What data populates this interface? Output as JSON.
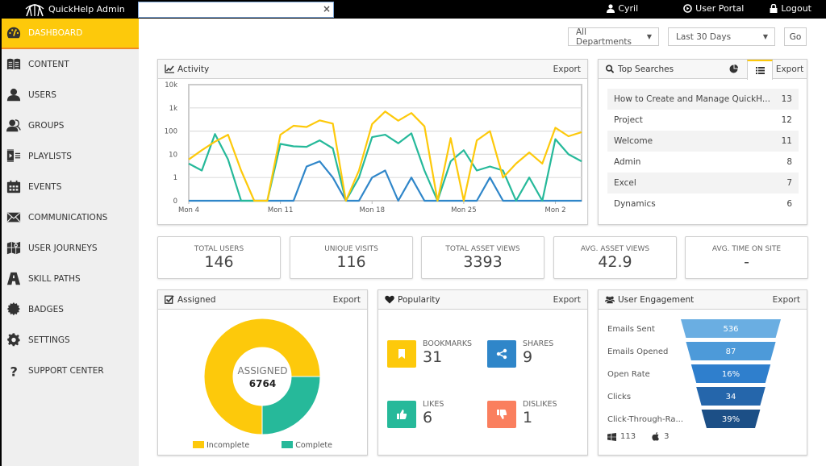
{
  "app": {
    "title": "QuickHelp Admin",
    "search_value": "",
    "user_name": "Cyril",
    "user_portal_label": "User Portal",
    "logout_label": "Logout"
  },
  "sidebar": {
    "items": [
      {
        "label": "DASHBOARD",
        "icon": "dashboard-icon",
        "active": true
      },
      {
        "label": "CONTENT",
        "icon": "book-icon"
      },
      {
        "label": "USERS",
        "icon": "user-icon"
      },
      {
        "label": "GROUPS",
        "icon": "group-icon"
      },
      {
        "label": "PLAYLISTS",
        "icon": "playlist-icon"
      },
      {
        "label": "EVENTS",
        "icon": "calendar-icon"
      },
      {
        "label": "COMMUNICATIONS",
        "icon": "envelope-icon"
      },
      {
        "label": "USER JOURNEYS",
        "icon": "map-icon"
      },
      {
        "label": "SKILL PATHS",
        "icon": "road-icon"
      },
      {
        "label": "BADGES",
        "icon": "badge-icon"
      },
      {
        "label": "SETTINGS",
        "icon": "gear-icon"
      },
      {
        "label": "SUPPORT CENTER",
        "icon": "question-icon"
      }
    ]
  },
  "filters": {
    "department": "All Departments",
    "range": "Last 30 Days",
    "go_label": "Go"
  },
  "activity": {
    "title": "Activity",
    "export_label": "Export"
  },
  "chart_data": {
    "type": "line",
    "title": "Activity",
    "yscale": "log",
    "y_ticks": [
      "0",
      "1",
      "10",
      "100",
      "1k",
      "10k"
    ],
    "x_ticks": [
      "Mon 4",
      "Mon 11",
      "Mon 18",
      "Mon 25",
      "Mon 2"
    ],
    "x_tick_day_index": [
      0,
      7,
      14,
      21,
      28
    ],
    "days": 31,
    "ylim": [
      0,
      10000
    ],
    "grid": true,
    "series": [
      {
        "name": "yellow",
        "color": "#fdc90b",
        "values": [
          6,
          15,
          35,
          70,
          2,
          0,
          0,
          70,
          170,
          150,
          290,
          210,
          0,
          2,
          200,
          700,
          280,
          600,
          160,
          0,
          50,
          0,
          40,
          100,
          1,
          4,
          12,
          4,
          140,
          60,
          90
        ]
      },
      {
        "name": "teal",
        "color": "#26b99a",
        "values": [
          4,
          2,
          75,
          6,
          0,
          0,
          0,
          28,
          22,
          21,
          40,
          18,
          0,
          1,
          55,
          70,
          30,
          80,
          2,
          0,
          5,
          15,
          2,
          3,
          2,
          0,
          1,
          0,
          45,
          10,
          5
        ]
      },
      {
        "name": "blue",
        "color": "#2f86c9",
        "values": [
          0,
          0,
          0,
          0,
          0,
          0,
          0,
          0,
          0,
          3,
          5,
          1,
          0,
          0,
          1,
          2,
          0,
          1,
          0,
          0,
          0,
          0,
          0,
          1,
          0,
          0,
          0,
          0,
          0,
          0,
          0
        ]
      }
    ]
  },
  "top_searches": {
    "title": "Top Searches",
    "export_label": "Export",
    "rows": [
      {
        "term": "How to Create and Manage QuickH...",
        "count": "13"
      },
      {
        "term": "Project",
        "count": "12"
      },
      {
        "term": "Welcome",
        "count": "11"
      },
      {
        "term": "Admin",
        "count": "8"
      },
      {
        "term": "Excel",
        "count": "7"
      },
      {
        "term": "Dynamics",
        "count": "6"
      }
    ]
  },
  "kpis": [
    {
      "label": "TOTAL USERS",
      "value": "146"
    },
    {
      "label": "UNIQUE VISITS",
      "value": "116"
    },
    {
      "label": "TOTAL ASSET VIEWS",
      "value": "3393"
    },
    {
      "label": "AVG. ASSET VIEWS",
      "value": "42.9"
    },
    {
      "label": "AVG. TIME ON SITE",
      "value": "-"
    }
  ],
  "assigned": {
    "title": "Assigned",
    "export_label": "Export",
    "center_label": "ASSIGNED",
    "center_value": "6764",
    "slices": [
      {
        "name": "Incomplete",
        "color": "#fdc90b",
        "fraction": 0.75
      },
      {
        "name": "Complete",
        "color": "#26b99a",
        "fraction": 0.25
      }
    ]
  },
  "popularity": {
    "title": "Popularity",
    "export_label": "Export",
    "items": [
      {
        "label": "BOOKMARKS",
        "value": "31",
        "color": "#fdc90b",
        "icon": "bookmark-icon"
      },
      {
        "label": "SHARES",
        "value": "9",
        "color": "#2f86c9",
        "icon": "share-icon"
      },
      {
        "label": "LIKES",
        "value": "6",
        "color": "#26b99a",
        "icon": "thumbs-up-icon"
      },
      {
        "label": "DISLIKES",
        "value": "1",
        "color": "#fa7f5e",
        "icon": "thumbs-down-icon"
      }
    ]
  },
  "engagement": {
    "title": "User Engagement",
    "export_label": "Export",
    "rows": [
      {
        "label": "Emails Sent",
        "value": "536",
        "color": "#6aaee2"
      },
      {
        "label": "Emails Opened",
        "value": "87",
        "color": "#4d9ad9"
      },
      {
        "label": "Open Rate",
        "value": "16%",
        "color": "#2f7fcd"
      },
      {
        "label": "Clicks",
        "value": "34",
        "color": "#2566ab"
      },
      {
        "label": "Click-Through-Ra...",
        "value": "39%",
        "color": "#1c4f86"
      }
    ],
    "windows_count": "113",
    "apple_count": "3"
  }
}
